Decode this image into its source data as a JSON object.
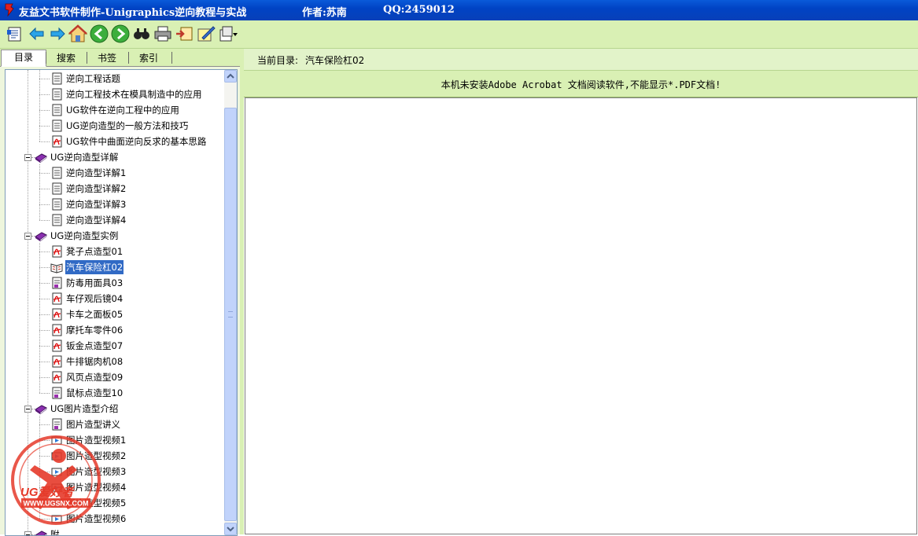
{
  "window": {
    "title": "友益文书软件制作-Unigraphics逆向教程与实战",
    "author": "作者:苏南",
    "qq": "QQ:2459012"
  },
  "toolbar": {
    "buttons": [
      "contents-icon",
      "back-arrow-icon",
      "forward-arrow-icon",
      "home-icon",
      "prev-circle-icon",
      "next-circle-icon",
      "find-icon",
      "print-icon",
      "export-icon",
      "edit-icon",
      "options-icon"
    ]
  },
  "tabs": [
    "目录",
    "搜索",
    "书签",
    "索引"
  ],
  "tree": [
    {
      "label": "逆向工程话题",
      "icon": "doc"
    },
    {
      "label": "逆向工程技术在模具制造中的应用",
      "icon": "doc"
    },
    {
      "label": "UG软件在逆向工程中的应用",
      "icon": "doc"
    },
    {
      "label": "UG逆向造型的一般方法和技巧",
      "icon": "doc"
    },
    {
      "label": "UG软件中曲面逆向反求的基本思路",
      "icon": "pdf"
    },
    {
      "label": "UG逆向造型详解",
      "icon": "book"
    },
    {
      "label": "逆向造型详解1",
      "icon": "doc"
    },
    {
      "label": "逆向造型详解2",
      "icon": "doc"
    },
    {
      "label": "逆向造型详解3",
      "icon": "doc"
    },
    {
      "label": "逆向造型详解4",
      "icon": "doc"
    },
    {
      "label": "UG逆向造型实例",
      "icon": "book"
    },
    {
      "label": "凳子点造型01",
      "icon": "pdf"
    },
    {
      "label": "汽车保险杠02",
      "icon": "open-book",
      "selected": true
    },
    {
      "label": "防毒用面具03",
      "icon": "doc2"
    },
    {
      "label": "车仔观后镜04",
      "icon": "pdf"
    },
    {
      "label": "卡车之面板05",
      "icon": "pdf"
    },
    {
      "label": "摩托车零件06",
      "icon": "pdf"
    },
    {
      "label": "钣金点造型07",
      "icon": "pdf"
    },
    {
      "label": "牛排锯肉机08",
      "icon": "pdf"
    },
    {
      "label": "风页点造型09",
      "icon": "pdf"
    },
    {
      "label": "鼠标点造型10",
      "icon": "doc2"
    },
    {
      "label": "UG图片造型介绍",
      "icon": "book"
    },
    {
      "label": "图片造型讲义",
      "icon": "doc2"
    },
    {
      "label": "图片造型视频1",
      "icon": "video"
    },
    {
      "label": "图片造型视频2",
      "icon": "video"
    },
    {
      "label": "图片造型视频3",
      "icon": "video"
    },
    {
      "label": "图片造型视频4",
      "icon": "video"
    },
    {
      "label": "图片造型视频5",
      "icon": "video"
    },
    {
      "label": "图片造型视频6",
      "icon": "video"
    },
    {
      "label": "附",
      "icon": "book"
    }
  ],
  "path": {
    "label": "当前目录:",
    "value": "汽车保险杠02"
  },
  "message": "本机未安装Adobe Acrobat 文档阅读软件,不能显示*.PDF文档!",
  "watermark": {
    "brand": "UG爱好者",
    "url": "WWW.UGSNX.COM"
  },
  "colors": {
    "titlebar": "#0043c4",
    "toolbar": "#d9f0b4",
    "selection": "#316ac5"
  }
}
